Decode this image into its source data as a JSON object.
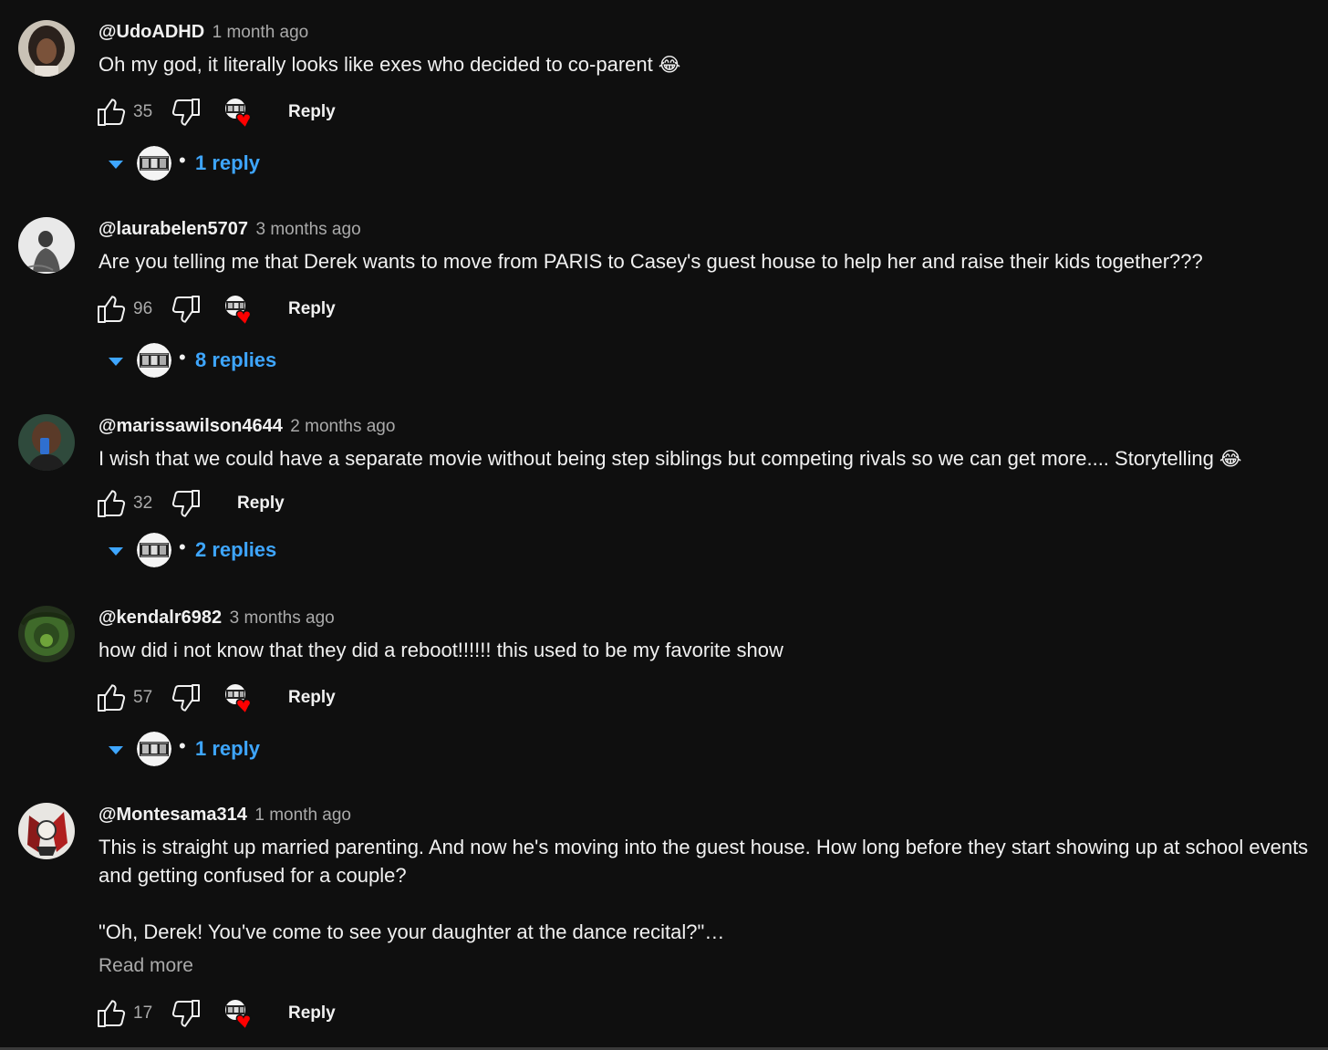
{
  "comments": [
    {
      "handle": "@UdoADHD",
      "time": "1 month ago",
      "text": [
        "Oh my god, it literally looks like exes who decided to co-parent"
      ],
      "emoji": "😂",
      "likes": "35",
      "reply_label": "Reply",
      "replies_label": "1 reply"
    },
    {
      "handle": "@laurabelen5707",
      "time": "3 months ago",
      "text": [
        "Are you telling me that Derek wants to move from PARIS to Casey's guest house to help her and raise their kids together???"
      ],
      "likes": "96",
      "reply_label": "Reply",
      "replies_label": "8 replies"
    },
    {
      "handle": "@marissawilson4644",
      "time": "2 months ago",
      "text": [
        "I wish that we could have a separate movie without being step siblings but competing rivals so we can get more.... Storytelling"
      ],
      "emoji": "😂",
      "likes": "32",
      "reply_label": "Reply",
      "replies_label": "2 replies"
    },
    {
      "handle": "@kendalr6982",
      "time": "3 months ago",
      "text": [
        "how did i not know that they did a reboot!!!!!! this used to be my favorite show"
      ],
      "likes": "57",
      "reply_label": "Reply",
      "replies_label": "1 reply"
    },
    {
      "handle": "@Montesama314",
      "time": "1 month ago",
      "text": [
        "This is straight up married parenting. And now he's moving into the guest house. How long before they start showing up at school events and getting confused for a couple?",
        "\"Oh, Derek! You've come to see your daughter at the dance recital?\"…"
      ],
      "read_more": "Read more",
      "likes": "17",
      "reply_label": "Reply"
    }
  ],
  "icons": {
    "like": "thumbs-up-icon",
    "dislike": "thumbs-down-icon",
    "creator_heart": "creator-heart-icon",
    "expand": "chevron-down-icon"
  },
  "colors": {
    "background": "#0f0f0f",
    "text": "#f1f1f1",
    "secondary_text": "#aaaaaa",
    "link_blue": "#3ea6ff",
    "heart_red": "#ff0000"
  }
}
